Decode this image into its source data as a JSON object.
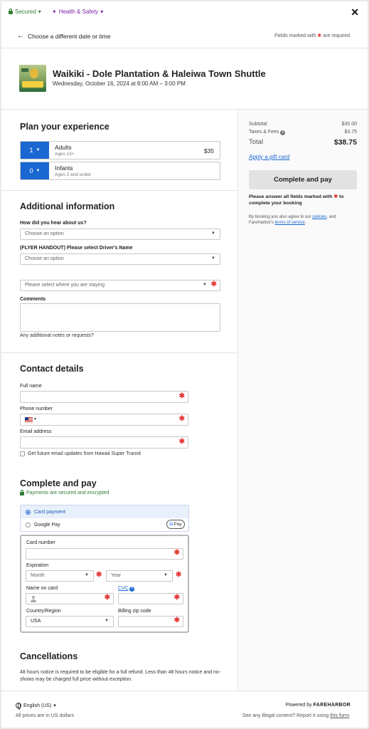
{
  "topbar": {
    "secured_label": "Secured",
    "health_label": "Health & Safety",
    "close_glyph": "✕"
  },
  "backrow": {
    "back_label": "Choose a different date or time",
    "required_prefix": "Fields marked with",
    "required_star": "✱",
    "required_suffix": "are required"
  },
  "tour": {
    "title": "Waikiki - Dole Plantation & Haleiwa Town Shuttle",
    "date": "Wednesday, October 16, 2024 at 8:00 AM – 3:00 PM"
  },
  "plan": {
    "heading": "Plan your experience",
    "tickets": [
      {
        "qty": "1",
        "name": "Adults",
        "sub": "Ages 13+",
        "price": "$35"
      },
      {
        "qty": "0",
        "name": "Infants",
        "sub": "Ages 2 and under",
        "price": ""
      }
    ]
  },
  "additional": {
    "heading": "Additional information",
    "hear_label": "How did you hear about us?",
    "hear_value": "Choose an option",
    "driver_label": "(FLYER HANDOUT) Please select Driver's Name",
    "driver_value": "Choose an option",
    "staying_value": "Please select where you are staying",
    "comments_label": "Comments",
    "comments_hint": "Any additional notes or requests?"
  },
  "contact": {
    "heading": "Contact details",
    "fullname_label": "Full name",
    "phone_label": "Phone number",
    "email_label": "Email address",
    "updates_label": "Get future email updates from Hawaii Super Transit"
  },
  "payment": {
    "heading": "Complete and pay",
    "secure_note": "Payments are secured and encrypted",
    "option_card": "Card payment",
    "option_google": "Google Pay",
    "gpay_g": "G",
    "gpay_text": "Pay",
    "card_number_label": "Card number",
    "expiration_label": "Expiration",
    "month_value": "Month",
    "year_value": "Year",
    "name_label": "Name on card",
    "cvc_label": "CVC",
    "country_label": "Country/Region",
    "country_value": "USA",
    "zip_label": "Billing zip code"
  },
  "cancellations": {
    "heading": "Cancellations",
    "text": "48 hours notice is required to be eligible for a full refund. Less than 48 hours notice and no-shows may be charged full price without exception."
  },
  "summary": {
    "subtotal_label": "Subtotal",
    "subtotal_value": "$35.00",
    "taxes_label": "Taxes & Fees",
    "taxes_value": "$3.75",
    "total_label": "Total",
    "total_value": "$38.75",
    "gift_label": "Apply a gift card",
    "pay_button": "Complete and pay",
    "answer_note_a": "Please answer all fields marked with",
    "answer_note_b": "to complete your booking",
    "agree_a": "By booking you also agree to our",
    "agree_policies": "policies",
    "agree_b": ", and FareHarbor's",
    "agree_terms": "terms of service",
    "agree_c": "."
  },
  "footer": {
    "language": "English (US)",
    "prices_note": "All prices are in US dollars",
    "powered_prefix": "Powered by",
    "powered_brand": "FAREHARBOR",
    "illegal_text": "See any illegal content? Report it using",
    "illegal_link": "this form",
    "illegal_end": "."
  },
  "colors": {
    "accent": "#1a67d2",
    "required": "#e53935",
    "secured": "#2e7d32",
    "health": "#7b1fa2"
  },
  "icons": [
    "lock-icon",
    "sparkle-icon",
    "close-icon",
    "arrow-left-icon",
    "chevron-down-icon",
    "info-icon",
    "globe-icon",
    "person-icon",
    "flag-us-icon"
  ]
}
